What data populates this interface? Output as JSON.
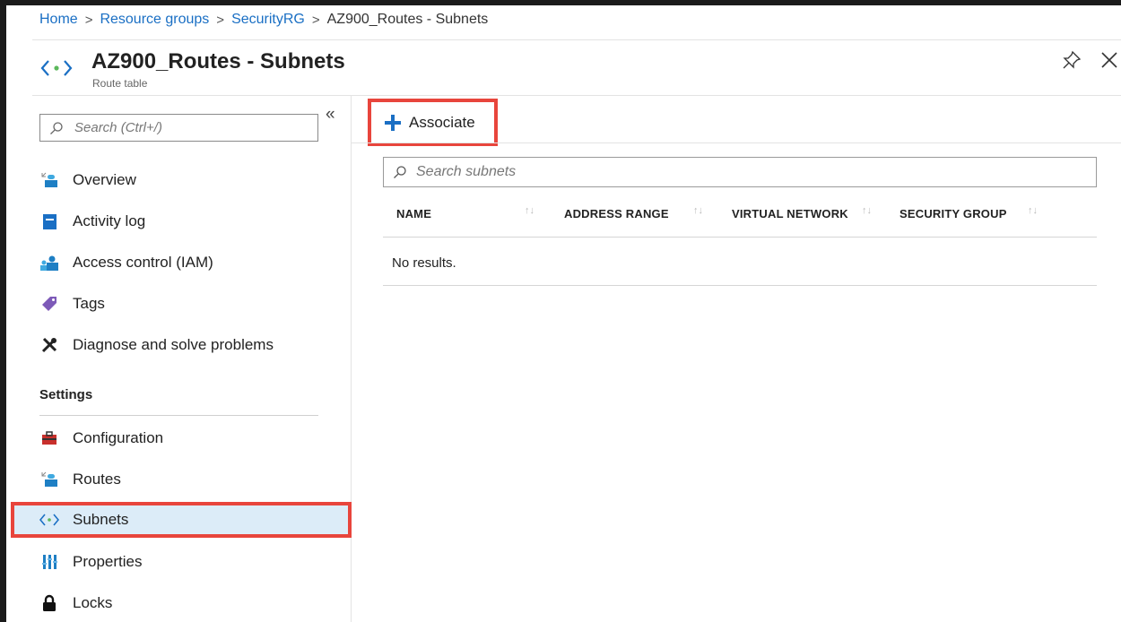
{
  "breadcrumb": {
    "items": [
      "Home",
      "Resource groups",
      "SecurityRG",
      "AZ900_Routes - Subnets"
    ],
    "separator": ">"
  },
  "header": {
    "title": "AZ900_Routes - Subnets",
    "subtitle": "Route table",
    "icon": "route-table-icon"
  },
  "sidebar": {
    "search_placeholder": "Search (Ctrl+/)",
    "collapse_label": "«",
    "items": [
      {
        "label": "Overview",
        "icon": "overview-icon"
      },
      {
        "label": "Activity log",
        "icon": "activity-log-icon"
      },
      {
        "label": "Access control (IAM)",
        "icon": "iam-icon"
      },
      {
        "label": "Tags",
        "icon": "tag-icon"
      },
      {
        "label": "Diagnose and solve problems",
        "icon": "wrench-icon"
      }
    ],
    "section_label": "Settings",
    "settings_items": [
      {
        "label": "Configuration",
        "icon": "toolbox-icon"
      },
      {
        "label": "Routes",
        "icon": "routes-icon"
      },
      {
        "label": "Subnets",
        "icon": "subnets-icon",
        "active": true
      },
      {
        "label": "Properties",
        "icon": "properties-icon"
      },
      {
        "label": "Locks",
        "icon": "lock-icon"
      }
    ]
  },
  "toolbar": {
    "associate_label": "Associate"
  },
  "subnets": {
    "search_placeholder": "Search subnets",
    "columns": [
      "NAME",
      "ADDRESS RANGE",
      "VIRTUAL NETWORK",
      "SECURITY GROUP"
    ],
    "sort_indicator": "↑↓",
    "empty_message": "No results."
  },
  "colors": {
    "accent": "#1a6fc4",
    "highlight": "#e8453c",
    "active_bg": "#dcecf8"
  }
}
